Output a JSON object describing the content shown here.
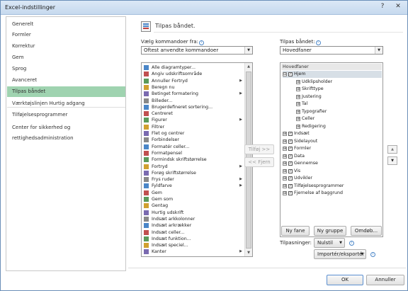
{
  "window": {
    "title": "Excel-indstillinger",
    "help_glyph": "?",
    "close_glyph": "✕"
  },
  "sidebar": {
    "items": [
      {
        "label": "Generelt"
      },
      {
        "label": "Formler"
      },
      {
        "label": "Korrektur"
      },
      {
        "label": "Gem"
      },
      {
        "label": "Sprog"
      },
      {
        "label": "Avanceret"
      },
      {
        "label": "Tilpas båndet",
        "active": true
      },
      {
        "label": "Værktøjslinjen Hurtig adgang"
      },
      {
        "label": "Tilføjelsesprogrammer"
      },
      {
        "label": "Center for sikkerhed og rettighedsadministration"
      }
    ]
  },
  "header": {
    "title": "Tilpas båndet.",
    "icon": "customize-ribbon-icon"
  },
  "left_panel": {
    "label": "Vælg kommandoer fra:",
    "combo_value": "Oftest anvendte kommandoer",
    "commands": [
      {
        "label": "Alle diagramtyper...",
        "icon": "chart-icon"
      },
      {
        "label": "Angiv udskriftsområde",
        "icon": "print-area-icon"
      },
      {
        "label": "Annuller Fortryd",
        "icon": "undo-icon",
        "submenu": true
      },
      {
        "label": "Beregn nu",
        "icon": "calculator-icon"
      },
      {
        "label": "Betinget formatering",
        "icon": "conditional-format-icon",
        "submenu": true
      },
      {
        "label": "Billeder...",
        "icon": "picture-icon"
      },
      {
        "label": "Brugerdefineret sortering...",
        "icon": "sort-icon"
      },
      {
        "label": "Centreret",
        "icon": "center-align-icon"
      },
      {
        "label": "Figurer",
        "icon": "shapes-icon",
        "submenu": true
      },
      {
        "label": "Filtrer",
        "icon": "filter-icon"
      },
      {
        "label": "Flet og centrer",
        "icon": "merge-center-icon"
      },
      {
        "label": "Forbindelser",
        "icon": "connections-icon"
      },
      {
        "label": "Formatér celler...",
        "icon": "format-cells-icon"
      },
      {
        "label": "Formatpensel",
        "icon": "format-painter-icon"
      },
      {
        "label": "Formindsk skriftstørrelse",
        "icon": "font-decrease-icon"
      },
      {
        "label": "Fortryd",
        "icon": "undo-icon",
        "submenu": true
      },
      {
        "label": "Forøg skriftstørrelse",
        "icon": "font-increase-icon"
      },
      {
        "label": "Frys ruder",
        "icon": "freeze-panes-icon",
        "submenu": true
      },
      {
        "label": "Fyldfarve",
        "icon": "fill-color-icon",
        "submenu": true
      },
      {
        "label": "Gem",
        "icon": "save-icon"
      },
      {
        "label": "Gem som",
        "icon": "save-as-icon"
      },
      {
        "label": "Gentag",
        "icon": "redo-icon"
      },
      {
        "label": "Hurtig udskrift",
        "icon": "quick-print-icon"
      },
      {
        "label": "Indsæt arkkolonner",
        "icon": "insert-columns-icon"
      },
      {
        "label": "Indsæt arkrækker",
        "icon": "insert-rows-icon"
      },
      {
        "label": "Indsæt celler...",
        "icon": "insert-cells-icon"
      },
      {
        "label": "Indsæt funktion...",
        "icon": "function-icon"
      },
      {
        "label": "Indsæt speciel...",
        "icon": "paste-special-icon"
      },
      {
        "label": "Kanter",
        "icon": "borders-icon",
        "submenu": true
      }
    ]
  },
  "middle": {
    "add_label": "Tilføj >>",
    "remove_label": "<< Fjern"
  },
  "right_panel": {
    "label": "Tilpas båndet:",
    "combo_value": "Hovedfaner",
    "tree_header": "Hovedfaner",
    "tree": [
      {
        "label": "Hjem",
        "level": 0,
        "exp": "⊟",
        "checked": true,
        "selected": true
      },
      {
        "label": "Udklipsholder",
        "level": 1,
        "exp": "⊞"
      },
      {
        "label": "Skrifttype",
        "level": 1,
        "exp": "⊞"
      },
      {
        "label": "Justering",
        "level": 1,
        "exp": "⊞"
      },
      {
        "label": "Tal",
        "level": 1,
        "exp": "⊞"
      },
      {
        "label": "Typografier",
        "level": 1,
        "exp": "⊞"
      },
      {
        "label": "Celler",
        "level": 1,
        "exp": "⊞"
      },
      {
        "label": "Redigering",
        "level": 1,
        "exp": "⊞"
      },
      {
        "label": "Indsæt",
        "level": 0,
        "exp": "⊞",
        "checked": true
      },
      {
        "label": "Sidelayout",
        "level": 0,
        "exp": "⊞",
        "checked": true
      },
      {
        "label": "Formler",
        "level": 0,
        "exp": "⊞",
        "checked": true
      },
      {
        "label": "Data",
        "level": 0,
        "exp": "⊞",
        "checked": true
      },
      {
        "label": "Gennemse",
        "level": 0,
        "exp": "⊞",
        "checked": true
      },
      {
        "label": "Vis",
        "level": 0,
        "exp": "⊞",
        "checked": true
      },
      {
        "label": "Udvikler",
        "level": 0,
        "exp": "⊞",
        "checked": true
      },
      {
        "label": "Tilføjelsesprogrammer",
        "level": 0,
        "exp": "⊞",
        "checked": true
      },
      {
        "label": "Fjernelse af baggrund",
        "level": 0,
        "exp": "⊞",
        "checked": true
      }
    ],
    "buttons": {
      "new_tab": "Ny fane",
      "new_group": "Ny gruppe",
      "rename": "Omdøb..."
    },
    "customizations_label": "Tilpasninger:",
    "reset_label": "Nulstil",
    "import_export_label": "Importér/eksportér",
    "move_up": "▲",
    "move_down": "▼"
  },
  "footer": {
    "ok": "OK",
    "cancel": "Annuller"
  },
  "check_glyph": "✓",
  "info_glyph": "i",
  "colors": {
    "active_sidebar": "#9fd3b0",
    "title_bar": "#c6d9ee"
  }
}
